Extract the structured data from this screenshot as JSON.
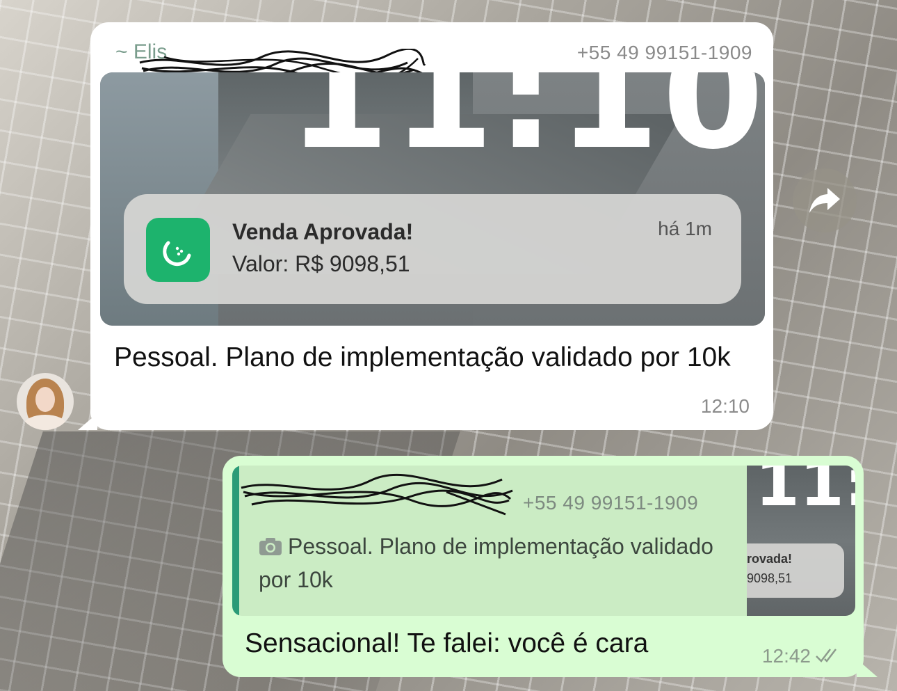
{
  "incoming": {
    "sender_name": "~ Elis",
    "sender_phone": "+55 49 99151-1909",
    "media": {
      "lock_time": "11:10",
      "notification": {
        "title": "Venda Aprovada!",
        "body": "Valor: R$ 9098,51",
        "time": "há 1m",
        "app_icon": "green-app-icon"
      }
    },
    "text": "Pessoal. Plano de implementação validado por 10k",
    "time": "12:10"
  },
  "outgoing": {
    "quote": {
      "sender_phone": "+55 49 99151-1909",
      "text": "Pessoal. Plano de implementação validado por 10k",
      "thumb_time": "11:1",
      "thumb_line1": "rovada!",
      "thumb_line2": "9098,51"
    },
    "text": "Sensacional! Te falei: você é cara",
    "time": "12:42",
    "status": "read"
  },
  "colors": {
    "incoming_bg": "#ffffff",
    "outgoing_bg": "#d9fdd3",
    "quote_bar": "#2b9b77",
    "app_icon": "#1db36d"
  }
}
